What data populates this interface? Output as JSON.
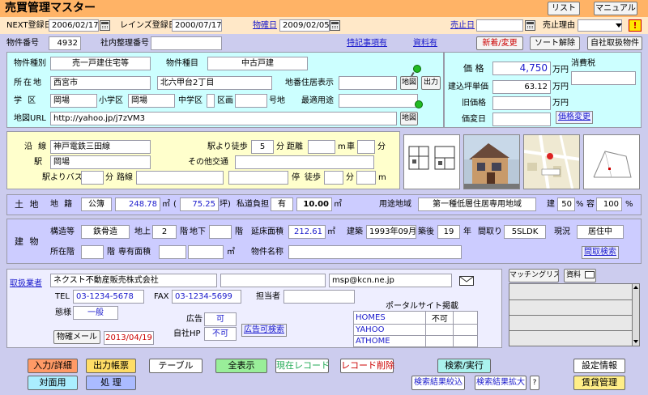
{
  "header": {
    "title": "売買管理マスター",
    "list_button": "リスト",
    "manual_button": "マニュアル",
    "warning_icon": "warning-icon"
  },
  "dates": {
    "next_reg_label": "NEXT登録日",
    "next_reg_value": "2006/02/17",
    "reins_label": "レインズ登録日",
    "reins_value": "2000/07/17",
    "bukken_date_label": "物確日",
    "bukken_date_value": "2009/02/05",
    "sold_date_label": "売止日",
    "sold_date_value": "",
    "sold_reason_label": "売止理由",
    "sold_reason_value": ""
  },
  "row2": {
    "number_label": "物件番号",
    "number_value": "4932",
    "internal_label": "社内整理番号",
    "internal_value": "",
    "special_link": "特記事項有",
    "material_link": "資料有",
    "new_change": "新着/変更",
    "sort_clear": "ソート解除",
    "own_listing": "自社取扱物件"
  },
  "property": {
    "type_label": "物件種別",
    "type_value": "売一戸建住宅等",
    "kind_label": "物件種目",
    "kind_value": "中古戸建",
    "location_label": "所在地",
    "city_value": "西宮市",
    "address_value": "北六甲台2丁目",
    "lot_label": "地番住居表示",
    "lot_value": "",
    "map_button": "地図",
    "output_button": "出力",
    "school_label": "学 区",
    "school_value": "岡場",
    "elem_label": "小学区",
    "elem_value": "岡場",
    "mid_label": "中学区",
    "mid_value": "",
    "ward_label": "区画",
    "ward_value": "",
    "lotno_label": "号地",
    "lotno_value": "",
    "route_label": "最適用途",
    "route_value": "",
    "map_url_label": "地図URL",
    "map_url_value": "http://yahoo.jp/j7zVM3",
    "map_url_button": "地図"
  },
  "price": {
    "price_label": "価 格",
    "price_value": "4,750",
    "unit": "万円",
    "tax_label": "消費税",
    "tax_value": "",
    "tsubo_label": "建込坪単価",
    "tsubo_value": "63.12",
    "old_price_label": "旧価格",
    "old_price_value": "",
    "change_date_label": "価変日",
    "change_date_value": "",
    "price_change_link": "価格変更"
  },
  "transport": {
    "line_label": "沿 線",
    "line_value": "神戸電鉄三田線",
    "walk_label": "駅より徒歩",
    "walk_value": "5",
    "min_label": "分",
    "dist_label": "距離",
    "dist_value": "",
    "m_label": "m",
    "car_label": "車",
    "car_value": "",
    "car_min": "分",
    "station_label": "駅",
    "station_value": "岡場",
    "other_label": "その他交通",
    "other_value": "",
    "bus_label": "駅よりバス",
    "bus_value": "",
    "bus_min": "分",
    "route_label": "路線",
    "route_value": "",
    "route2_value": "",
    "stop_label": "停",
    "stop_walk_label": "徒歩",
    "stop_walk_value": "",
    "stop_min": "分",
    "stop_m_value": "",
    "stop_m": "m"
  },
  "land": {
    "section_label": "土 地",
    "category_label": "地 籍",
    "category_value": "公簿",
    "area1_value": "248.78",
    "sqm": "㎡",
    "paren": "(",
    "area2_value": "75.25",
    "tsubo": "坪)",
    "private_label": "私道負担",
    "private_value": "有",
    "private_area_value": "10.00",
    "zone_label": "用途地域",
    "zone_value": "第一種低層住居専用地域",
    "bcr_label": "建",
    "bcr_value": "50",
    "pct": "%",
    "far_label": "容",
    "far_value": "100",
    "pct2": "%"
  },
  "building": {
    "section_label": "建 物",
    "structure_label": "構造等",
    "structure_value": "鉄骨造",
    "above_label": "地上",
    "above_value": "2",
    "floor_label": "階",
    "below_label": "地下",
    "below_value": "",
    "floor2_label": "階",
    "total_area_label": "延床面積",
    "total_area_value": "212.61",
    "sqm": "㎡",
    "built_label": "建築",
    "built_value": "1993年09月",
    "age_label": "築後",
    "age_value": "19",
    "year_label": "年",
    "layout_label": "間取り",
    "layout_value": "5SLDK",
    "status_label": "現況",
    "status_value": "居住中",
    "located_floor_label": "所在階",
    "located_floor_value": "",
    "floor3_label": "階",
    "exclusive_label": "専有面積",
    "exclusive_value": "",
    "exclusive2_value": "",
    "sqm2": "㎡",
    "name_label": "物件名称",
    "name_value": "",
    "layout_search": "間取検索"
  },
  "agent": {
    "agent_link": "取扱業者",
    "company_value": "ネクスト不動産販売株式会社",
    "company2_value": "",
    "email_value": "msp@kcn.ne.jp",
    "tel_label": "TEL",
    "tel_value": "03-1234-5678",
    "fax_label": "FAX",
    "fax_value": "03-1234-5699",
    "person_label": "担当者",
    "person_value": "",
    "mode_label": "態様",
    "mode_value": "一般",
    "ad_label": "広告",
    "ad_value": "可",
    "own_hp_label": "自社HP",
    "own_hp_value": "不可",
    "ad_search": "広告可検索",
    "confirm_mail": "物確メール",
    "confirm_date": "2013/04/19",
    "portal_title": "ポータルサイト掲載",
    "portals": [
      {
        "name": "HOMES",
        "value": "不可",
        "extra": ""
      },
      {
        "name": "YAHOO",
        "value": "",
        "extra": ""
      },
      {
        "name": "ATHOME",
        "value": "",
        "extra": ""
      }
    ],
    "mail_icon": "mail-icon"
  },
  "matching": {
    "list_button": "マッチングリスト",
    "material_button": "資料"
  },
  "footer": {
    "input_detail": "入力/詳細",
    "output_doc": "出力帳票",
    "table": "テーブル",
    "show_all": "全表示",
    "current_record": "現在レコード",
    "delete_record": "レコード削除",
    "search_run": "検索/実行",
    "settings": "設定情報",
    "face_to_face": "対面用",
    "process": "処 理",
    "narrow": "検索結果絞込",
    "expand": "検索結果拡大",
    "help": "?",
    "rental": "賃貸管理"
  },
  "colors": {
    "header_bg": "#ffb366",
    "date_row_bg": "#ffe8c8",
    "property_bg": "#ccffff",
    "transport_bg": "#ffffcc",
    "form_bg": "#ccccff",
    "agent_bg": "#eeeeff"
  }
}
